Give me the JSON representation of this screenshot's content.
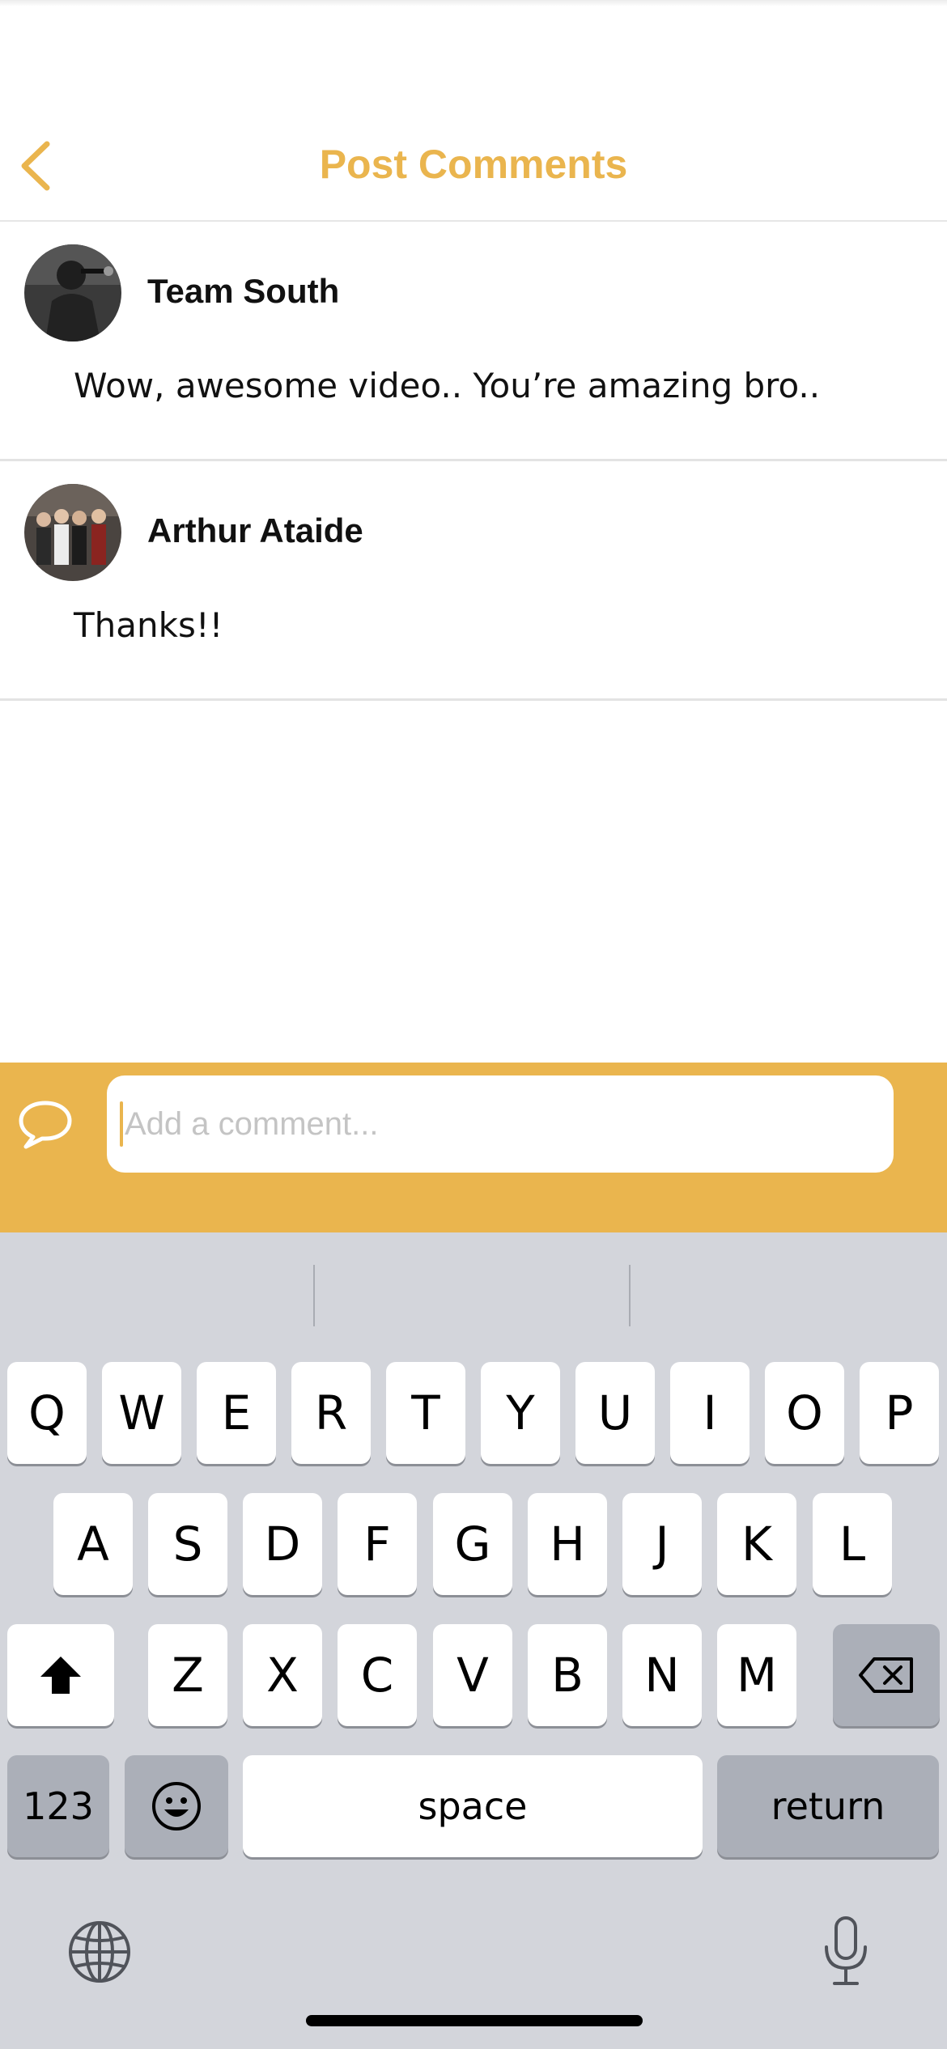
{
  "nav": {
    "title": "Post Comments",
    "back_icon": "chevron-left-icon"
  },
  "comments": [
    {
      "author": "Team South",
      "text": "Wow, awesome video.. You’re amazing bro.."
    },
    {
      "author": "Arthur Ataide",
      "text": "Thanks!!"
    }
  ],
  "composer": {
    "placeholder": "Add a comment...",
    "icon": "speech-bubble-icon"
  },
  "keyboard": {
    "row1": [
      "Q",
      "W",
      "E",
      "R",
      "T",
      "Y",
      "U",
      "I",
      "O",
      "P"
    ],
    "row2": [
      "A",
      "S",
      "D",
      "F",
      "G",
      "H",
      "J",
      "K",
      "L"
    ],
    "row3": [
      "Z",
      "X",
      "C",
      "V",
      "B",
      "N",
      "M"
    ],
    "numbers_label": "123",
    "space_label": "space",
    "return_label": "return"
  },
  "colors": {
    "accent": "#eab54e",
    "keyboard_bg": "#d3d5db"
  }
}
